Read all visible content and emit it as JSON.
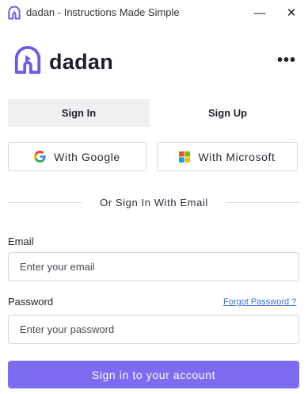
{
  "window": {
    "title": "dadan - Instructions Made Simple",
    "minimize_glyph": "—",
    "close_glyph": "✕"
  },
  "brand": {
    "name": "dadan",
    "accent": "#7c6cf2",
    "logo_icon": "dadan-logo-icon"
  },
  "menu": {
    "more_glyph": "•••",
    "icon": "more-horizontal-icon"
  },
  "tabs": [
    {
      "label": "Sign In",
      "active": true
    },
    {
      "label": "Sign Up",
      "active": false
    }
  ],
  "oauth": {
    "google_label": "With Google",
    "microsoft_label": "With Microsoft"
  },
  "divider_label": "Or Sign In With Email",
  "form": {
    "email_label": "Email",
    "email_placeholder": "Enter your email",
    "password_label": "Password",
    "password_placeholder": "Enter your password",
    "forgot_label": "Forgot Password ?",
    "submit_label": "Sign in to your account"
  }
}
